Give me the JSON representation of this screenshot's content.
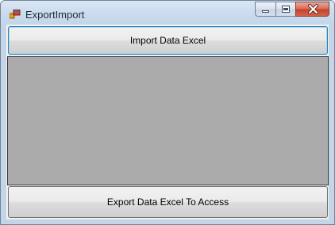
{
  "window": {
    "title": "ExportImport",
    "icon": "form-app-icon",
    "caption_buttons": [
      "minimize-icon",
      "maximize-icon",
      "close-icon"
    ]
  },
  "main": {
    "import_button_label": "Import Data Excel",
    "export_button_label": "Export Data Excel To Access",
    "grid_background": "#ababab"
  },
  "colors": {
    "titlebar": "#cdddef",
    "client": "#f0f0f0",
    "close_button": "#c3432a",
    "focus_border": "#3c7fb1"
  }
}
